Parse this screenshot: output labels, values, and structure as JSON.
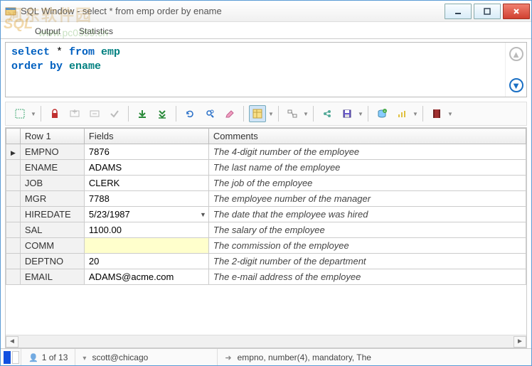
{
  "window": {
    "title": "SQL Window - select * from emp order by ename"
  },
  "watermark": {
    "text1": "河东软件园",
    "text2": "www.pc0359.cn"
  },
  "tabs": {
    "output": "Output",
    "statistics": "Statistics"
  },
  "sql": {
    "line1_kw1": "select",
    "line1_op": " * ",
    "line1_kw2": "from",
    "line1_tbl": " emp",
    "line2_kw1": "order",
    "line2_kw2": " by",
    "line2_col": " ename"
  },
  "headers": {
    "row": "Row 1",
    "fields": "Fields",
    "comments": "Comments"
  },
  "rows": [
    {
      "field": "EMPNO",
      "value": "7876",
      "comment": "The 4-digit number of the employee",
      "sel": true
    },
    {
      "field": "ENAME",
      "value": "ADAMS",
      "comment": "The last name of the employee"
    },
    {
      "field": "JOB",
      "value": "CLERK",
      "comment": "The job of the employee"
    },
    {
      "field": "MGR",
      "value": "7788",
      "comment": "The employee number of the manager"
    },
    {
      "field": "HIREDATE",
      "value": "5/23/1987",
      "comment": "The date that the employee was hired",
      "dd": true
    },
    {
      "field": "SAL",
      "value": "1100.00",
      "comment": "The salary of the employee"
    },
    {
      "field": "COMM",
      "value": "",
      "comment": "The commission of the employee",
      "hl": true
    },
    {
      "field": "DEPTNO",
      "value": "20",
      "comment": "The 2-digit number of the department"
    },
    {
      "field": "EMAIL",
      "value": "ADAMS@acme.com",
      "comment": "The e-mail address of the employee"
    }
  ],
  "status": {
    "count": "1 of 13",
    "conn": "scott@chicago",
    "info": "empno, number(4), mandatory, The"
  }
}
